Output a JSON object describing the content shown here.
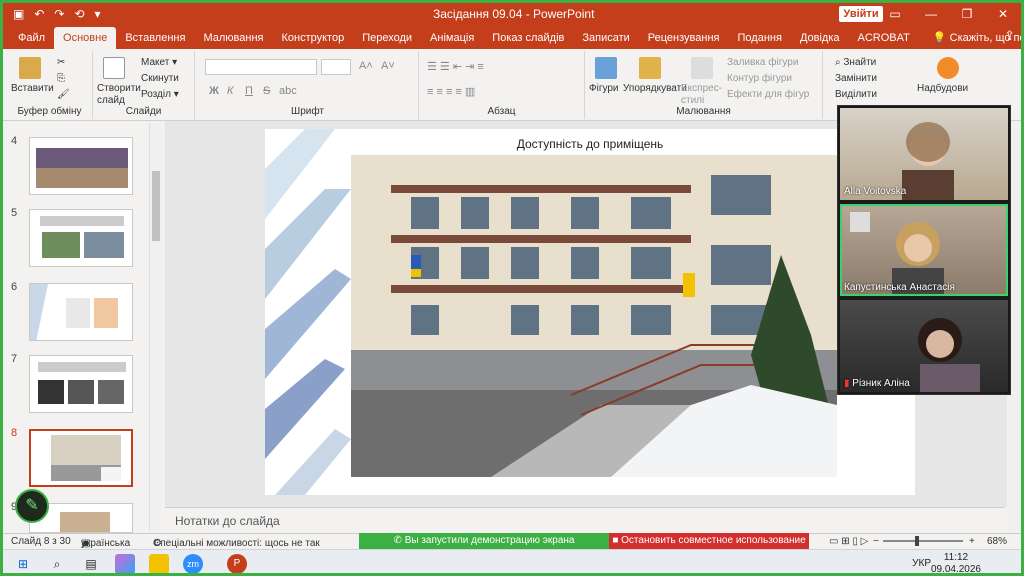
{
  "titlebar": {
    "title": "Засідання 09.04  -  PowerPoint",
    "signin": "Увійти",
    "quick_access": [
      "save-icon",
      "undo-icon",
      "redo-icon",
      "start-icon",
      "more-icon"
    ],
    "window_controls": [
      "ribbon-options-icon",
      "minimize-icon",
      "restore-icon",
      "close-icon"
    ]
  },
  "tabs": [
    "Файл",
    "Основне",
    "Вставлення",
    "Малювання",
    "Конструктор",
    "Переходи",
    "Анімація",
    "Показ слайдів",
    "Записати",
    "Рецензування",
    "Подання",
    "Довідка",
    "ACROBAT"
  ],
  "active_tab": "Основне",
  "tell_me": "Скажіть, що потрібно зробити",
  "ribbon": {
    "clipboard": {
      "label": "Буфер обміну",
      "paste": "Вставити"
    },
    "slides": {
      "label": "Слайди",
      "new_slide": "Створити слайд",
      "layout": "Макет",
      "reset": "Скинути",
      "section": "Розділ"
    },
    "font": {
      "label": "Шрифт",
      "bold": "Ж",
      "italic": "К",
      "underline": "П",
      "strike": "S",
      "shadow": "abc"
    },
    "paragraph": {
      "label": "Абзац"
    },
    "drawing": {
      "label": "Малювання",
      "shapes": "Фігури",
      "arrange": "Упорядкувати",
      "quick_styles": "Експрес-стилі",
      "fill": "Заливка фігури",
      "outline": "Контур фігури",
      "effects": "Ефекти для фігур"
    },
    "editing": {
      "find": "Знайти",
      "replace": "Замінити",
      "select": "Виділити"
    },
    "addins": {
      "label": "Надбудови"
    }
  },
  "thumbnails": [
    {
      "num": "4"
    },
    {
      "num": "5"
    },
    {
      "num": "6"
    },
    {
      "num": "7"
    },
    {
      "num": "8"
    },
    {
      "num": "9"
    }
  ],
  "slide": {
    "title": "Доступність до приміщень"
  },
  "notes_placeholder": "Нотатки до слайда",
  "participants": [
    {
      "name": "Alla Voitovska"
    },
    {
      "name": "Капустинська Анастасія"
    },
    {
      "name": "Різник  Аліна"
    }
  ],
  "status": {
    "slide_count": "Слайд 8 з 30",
    "language": "українська",
    "accessibility": "Спеціальні можливості: щось не так",
    "sharing": "Вы запустили демонстрацию экрана",
    "stop_sharing": "Остановить совместное использование",
    "zoom": "68%"
  },
  "taskbar": {
    "lang": "УКР",
    "time": "11:12",
    "date": "09.04.2026"
  },
  "colors": {
    "accent": "#c43e1c",
    "share_green": "#3cb043",
    "stop_red": "#d32f2f"
  }
}
